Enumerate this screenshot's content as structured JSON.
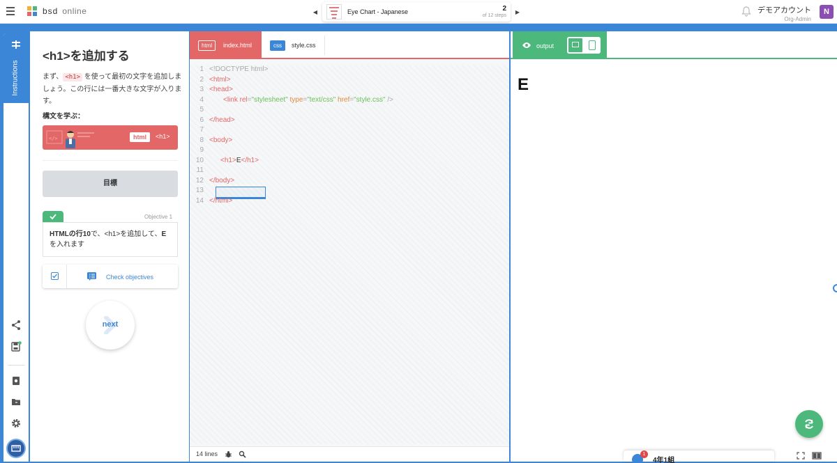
{
  "app": {
    "brand": "bsd",
    "brand_sub": "online",
    "colors": {
      "accent": "#3b86d6",
      "html": "#e36767",
      "output": "#4db87b",
      "avatar": "#8b4fb3"
    }
  },
  "stepper": {
    "title": "Eye Chart - Japanese",
    "current": "2",
    "total_label": "of 12 steps",
    "prev_icon": "skip-previous-icon",
    "next_icon": "skip-next-icon"
  },
  "account": {
    "name": "デモアカウント",
    "role": "Org-Admin",
    "avatar_letter": "N"
  },
  "rail": {
    "tab_label": "Instructions"
  },
  "instructions": {
    "title": "<h1>を追加する",
    "intro_before": "まず、",
    "intro_code": "<h1>",
    "intro_after": "を使って最初の文字を追加しましょう。この行には一番大きな文字が入ります。",
    "learn_label": "構文を学ぶ：",
    "banner_lang": "html",
    "banner_tag": "<h1>",
    "goal_label": "目標",
    "objective_label": "Objective 1",
    "objective_strong": "HTMLの行10",
    "objective_mid": "で、<h1>を追加して、",
    "objective_e": "E",
    "objective_end": "を入れます",
    "check_label": "Check objectives",
    "next_label": "next"
  },
  "editor": {
    "tabs": [
      {
        "lang": "html",
        "file": "index.html"
      },
      {
        "lang": "css",
        "file": "style.css"
      }
    ],
    "lines_label": "14 lines",
    "code": {
      "l1": "<!DOCTYPE html>",
      "l2": "<html>",
      "l3": "<head>",
      "l4_open": "<link ",
      "l4_rel": "rel",
      "l4_rel_v": "\"stylesheet\"",
      "l4_type": "type",
      "l4_type_v": "\"text/css\"",
      "l4_href": "href",
      "l4_href_v": "\"style.css\"",
      "l4_close": " />",
      "l6": "</head>",
      "l8": "<body>",
      "l10_open": "<h1>",
      "l10_text": "E",
      "l10_close": "</h1>",
      "l12": "</body>",
      "l14": "</html>"
    },
    "line_numbers": [
      "1",
      "2",
      "3",
      "4",
      "5",
      "6",
      "7",
      "8",
      "9",
      "10",
      "11",
      "12",
      "13",
      "14"
    ]
  },
  "output": {
    "tab_label": "output",
    "rendered_text": "E",
    "class_name": "4年1組",
    "notif_count": "1"
  }
}
